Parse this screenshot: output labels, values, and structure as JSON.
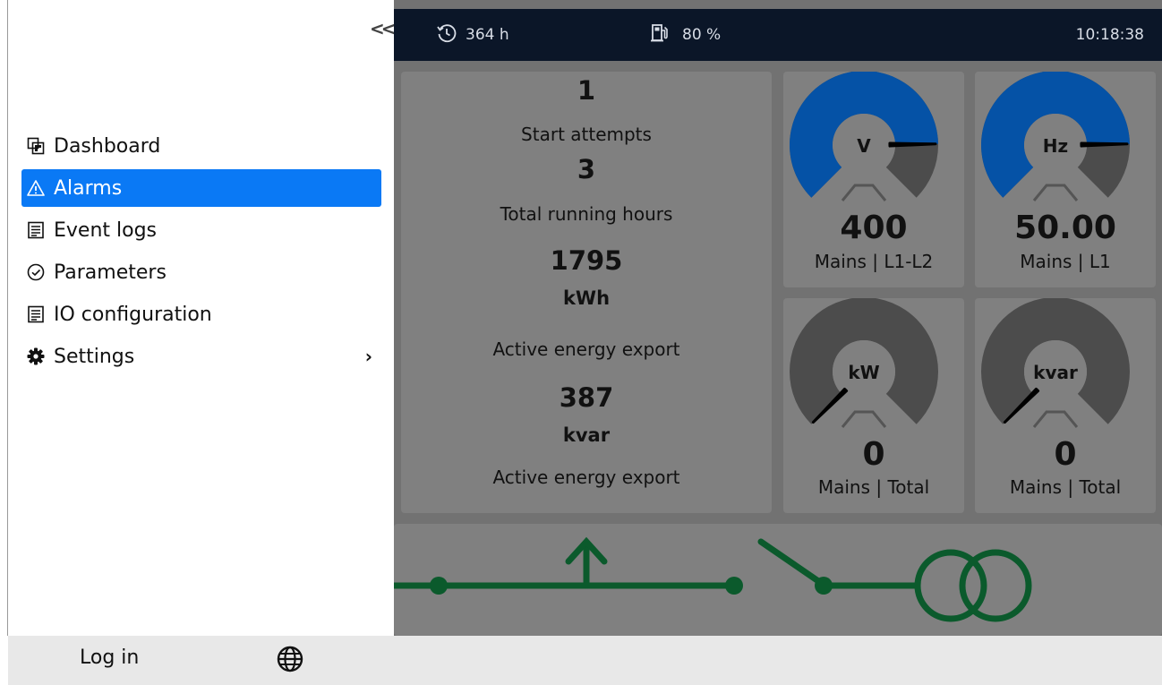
{
  "sidebar": {
    "items": [
      {
        "label": "Dashboard",
        "icon": "dashboard-icon"
      },
      {
        "label": "Alarms",
        "icon": "warning-icon",
        "active": true
      },
      {
        "label": "Event logs",
        "icon": "list-icon"
      },
      {
        "label": "Parameters",
        "icon": "check-circle-icon"
      },
      {
        "label": "IO configuration",
        "icon": "list-icon"
      },
      {
        "label": "Settings",
        "icon": "gear-icon"
      }
    ]
  },
  "footer": {
    "login_label": "Log in"
  },
  "topbar": {
    "hours": "364 h",
    "fuel": "80 %",
    "time": "10:18:38"
  },
  "stats": {
    "start_attempts_value": "1",
    "start_attempts_label": "Start attempts",
    "running_hours_value": "3",
    "running_hours_label": "Total running hours",
    "energy_kwh_value": "1795",
    "energy_kwh_unit": "kWh",
    "energy_kwh_label": "Active energy export",
    "energy_kvar_value": "387",
    "energy_kvar_unit": "kvar",
    "energy_kvar_label": "Active energy export"
  },
  "gauges": [
    {
      "unit": "V",
      "value": "400",
      "source": "Mains | L1-L2",
      "fill_fraction": 0.83
    },
    {
      "unit": "Hz",
      "value": "50.00",
      "source": "Mains | L1",
      "fill_fraction": 0.83
    },
    {
      "unit": "kW",
      "value": "0",
      "source": "Mains | Total",
      "fill_fraction": 0
    },
    {
      "unit": "kvar",
      "value": "0",
      "source": "Mains | Total",
      "fill_fraction": 0
    }
  ],
  "colors": {
    "accent": "#0a79f5",
    "gauge_fill": "#0552a6",
    "gauge_track": "#4c4c4c",
    "line": "#0b5a2c",
    "topbar": "#0b1628"
  }
}
